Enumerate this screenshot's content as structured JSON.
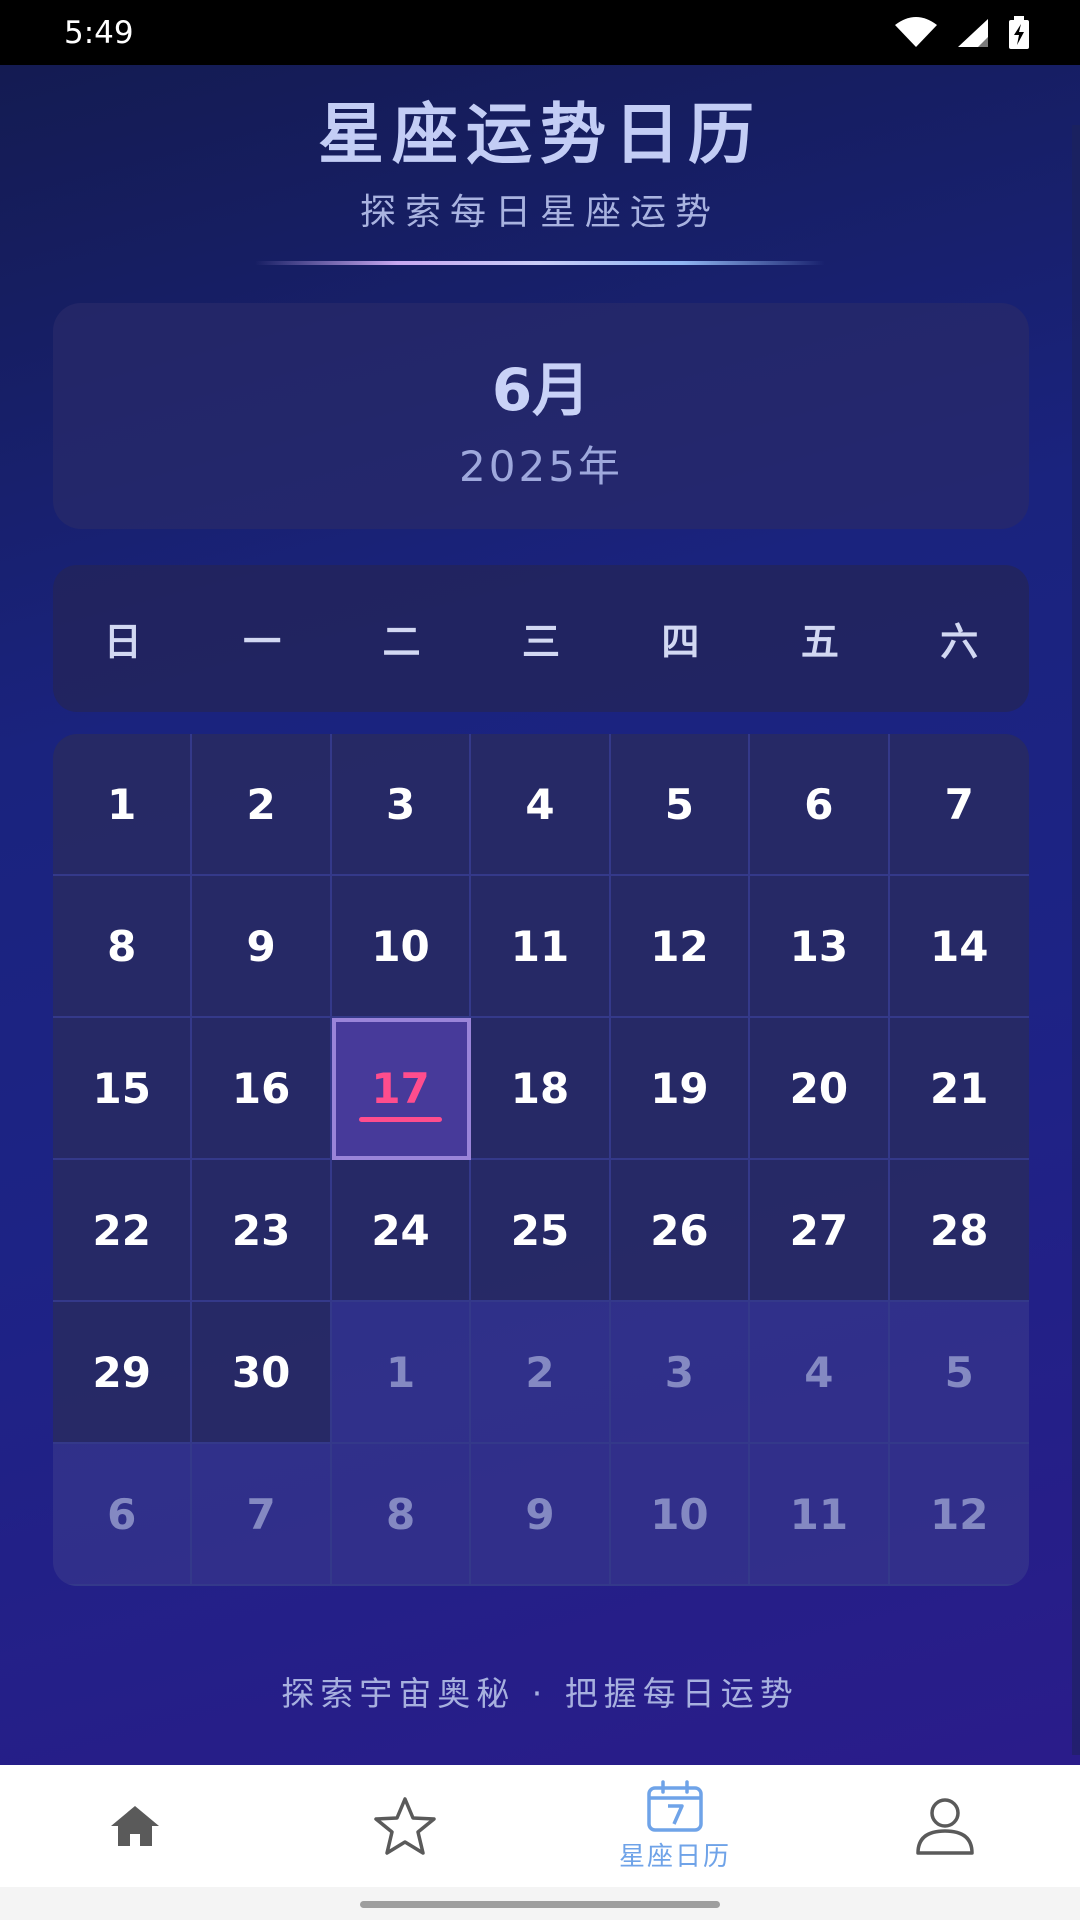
{
  "status_bar": {
    "time": "5:49"
  },
  "header": {
    "title": "星座运势日历",
    "subtitle": "探索每日星座运势"
  },
  "month_card": {
    "month": "6月",
    "year": "2025年"
  },
  "weekdays": [
    "日",
    "一",
    "二",
    "三",
    "四",
    "五",
    "六"
  ],
  "calendar": {
    "today": "17",
    "days": [
      {
        "d": "1",
        "other": false
      },
      {
        "d": "2",
        "other": false
      },
      {
        "d": "3",
        "other": false
      },
      {
        "d": "4",
        "other": false
      },
      {
        "d": "5",
        "other": false
      },
      {
        "d": "6",
        "other": false
      },
      {
        "d": "7",
        "other": false
      },
      {
        "d": "8",
        "other": false
      },
      {
        "d": "9",
        "other": false
      },
      {
        "d": "10",
        "other": false
      },
      {
        "d": "11",
        "other": false
      },
      {
        "d": "12",
        "other": false
      },
      {
        "d": "13",
        "other": false
      },
      {
        "d": "14",
        "other": false
      },
      {
        "d": "15",
        "other": false
      },
      {
        "d": "16",
        "other": false
      },
      {
        "d": "17",
        "other": false,
        "today": true
      },
      {
        "d": "18",
        "other": false
      },
      {
        "d": "19",
        "other": false
      },
      {
        "d": "20",
        "other": false
      },
      {
        "d": "21",
        "other": false
      },
      {
        "d": "22",
        "other": false
      },
      {
        "d": "23",
        "other": false
      },
      {
        "d": "24",
        "other": false
      },
      {
        "d": "25",
        "other": false
      },
      {
        "d": "26",
        "other": false
      },
      {
        "d": "27",
        "other": false
      },
      {
        "d": "28",
        "other": false
      },
      {
        "d": "29",
        "other": false
      },
      {
        "d": "30",
        "other": false
      },
      {
        "d": "1",
        "other": true
      },
      {
        "d": "2",
        "other": true
      },
      {
        "d": "3",
        "other": true
      },
      {
        "d": "4",
        "other": true
      },
      {
        "d": "5",
        "other": true
      },
      {
        "d": "6",
        "other": true
      },
      {
        "d": "7",
        "other": true
      },
      {
        "d": "8",
        "other": true
      },
      {
        "d": "9",
        "other": true
      },
      {
        "d": "10",
        "other": true
      },
      {
        "d": "11",
        "other": true
      },
      {
        "d": "12",
        "other": true
      }
    ]
  },
  "footer": {
    "tagline": "探索宇宙奥秘 · 把握每日运势"
  },
  "bottom_nav": {
    "items": [
      {
        "icon": "home-icon",
        "label": ""
      },
      {
        "icon": "star-icon",
        "label": ""
      },
      {
        "icon": "calendar-icon",
        "label": "星座日历",
        "active": true
      },
      {
        "icon": "person-icon",
        "label": ""
      }
    ]
  },
  "colors": {
    "accent_today": "#ff4d8d",
    "nav_active": "#6fa3e8",
    "background_top": "#141b52",
    "background_bottom": "#2a1c8a"
  }
}
